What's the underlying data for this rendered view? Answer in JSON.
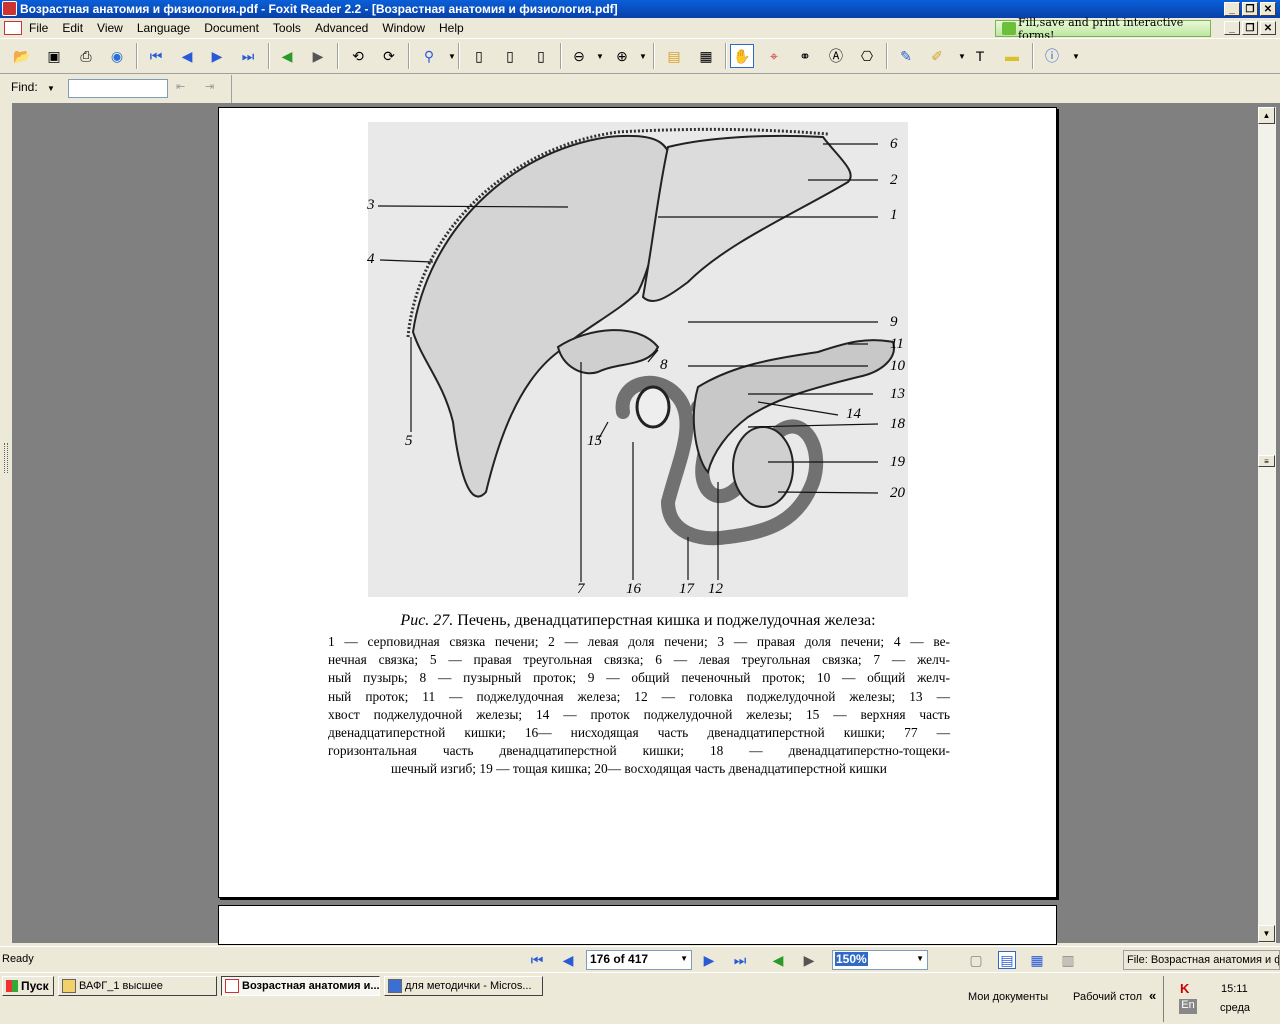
{
  "window": {
    "title": "Возрастная анатомия и физиология.pdf - Foxit Reader 2.2 - [Возрастная анатомия и физиология.pdf]",
    "promo_text": "Fill,save and print interactive forms!"
  },
  "menu": [
    "File",
    "Edit",
    "View",
    "Language",
    "Document",
    "Tools",
    "Advanced",
    "Window",
    "Help"
  ],
  "find": {
    "label": "Find:",
    "value": ""
  },
  "figure": {
    "labels": [
      "6",
      "2",
      "3",
      "1",
      "4",
      "9",
      "11",
      "10",
      "8",
      "13",
      "14",
      "18",
      "15",
      "5",
      "19",
      "20",
      "7",
      "16",
      "17",
      "12"
    ],
    "caption_prefix": "Рис. 27.",
    "caption_title": " Печень, двенадцатиперстная кишка и поджелудочная железа:",
    "caption_lines": [
      "1 — серповидная связка печени; 2 — левая доля печени; 3 — правая доля печени; 4 — ве-",
      "нечная связка; 5 — правая треугольная связка; 6 — левая треугольная связка; 7 — желч-",
      "ный пузырь; 8 — пузырный проток; 9 — общий печеночный проток; 10 — общий желч-",
      "ный проток; 11 — поджелудочная железа; 12 — головка поджелудочной железы; 13 —",
      "хвост поджелудочной железы; 14 — проток поджелудочной железы; 15 — верхняя часть",
      "двенадцатиперстной кишки; 16— нисходящая часть двенадцатиперстной кишки; 77 —",
      "горизонтальная часть двенадцатиперстной кишки; 18 — двенадцатиперстно-тощеки-",
      "шечный изгиб; 19 — тощая кишка; 20— восходящая часть двенадцатиперстной кишки"
    ]
  },
  "statusbar": {
    "status": "Ready",
    "page_indicator": "176 of 417",
    "zoom": "150%",
    "file_label": "File: Возрастная анатомия и физиология.pdf"
  },
  "taskbar": {
    "start_label": "Пуск",
    "tasks": [
      "ВАФГ_1 высшее",
      "Возрастная анатомия и...",
      "для методички - Micros..."
    ],
    "quick_links": [
      "Мои документы",
      "Рабочий стол"
    ],
    "tray": {
      "lang": "En",
      "time": "15:11",
      "day": "среда"
    }
  }
}
